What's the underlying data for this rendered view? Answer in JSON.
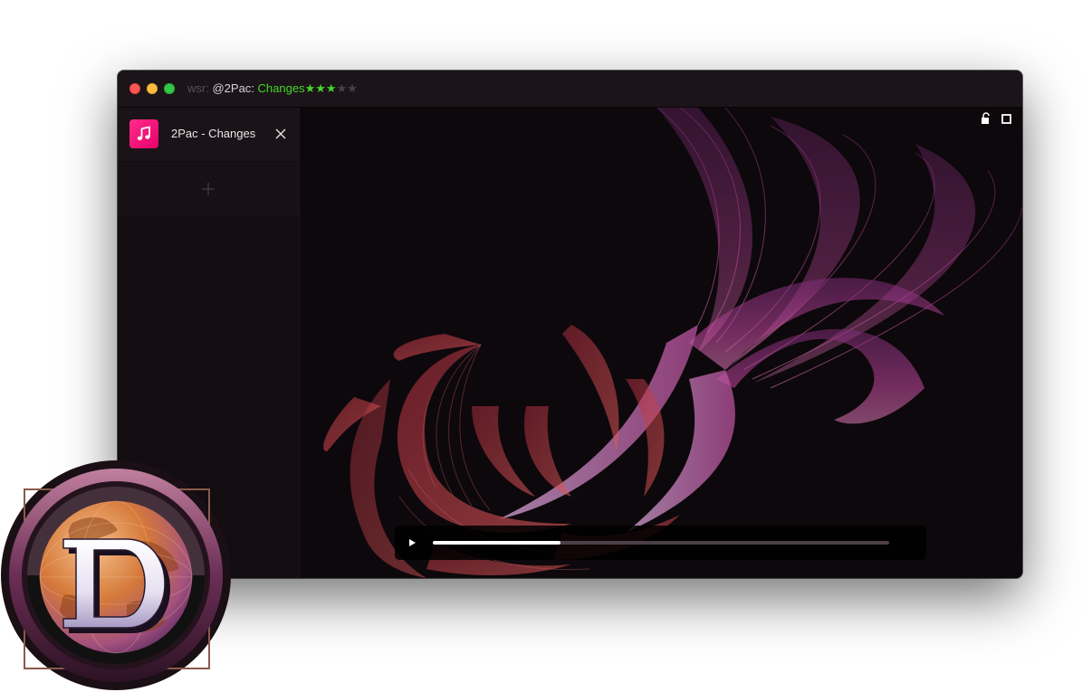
{
  "window": {
    "title_prefix": "wsr:",
    "artist": "@2Pac:",
    "song": "Changes",
    "rating": {
      "stars": [
        "★",
        "★",
        "★",
        "★",
        "★"
      ],
      "value": 3,
      "max": 5
    }
  },
  "sidebar": {
    "tabs": [
      {
        "label": "2Pac - Changes",
        "icon": "music-note-icon",
        "active": true
      }
    ],
    "add_icon": "plus-icon"
  },
  "viewer": {
    "icons": [
      "lock-open-icon",
      "fullscreen-icon"
    ],
    "player": {
      "play_icon": "play-icon",
      "progress": 0.28
    }
  },
  "logo": {
    "letter": "D"
  },
  "colors": {
    "accent_green": "#44d62c",
    "music_tile": "#ff2d8a",
    "window_bg": "#0f0a0d",
    "visual_pink": "#c0409f",
    "visual_red": "#c83c4c"
  }
}
